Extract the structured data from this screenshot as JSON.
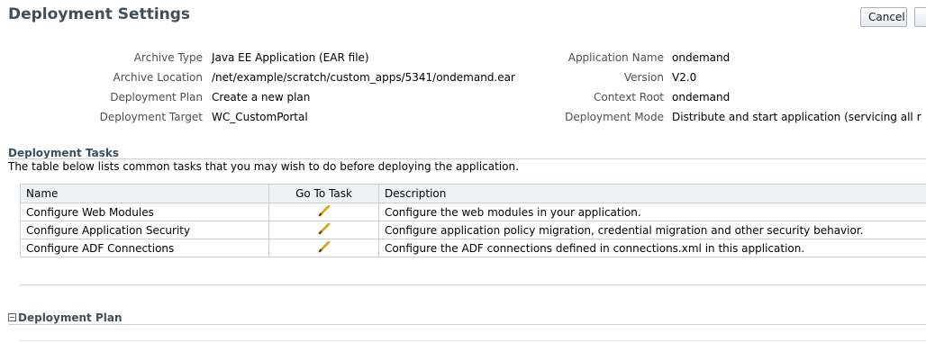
{
  "header": {
    "title": "Deployment Settings",
    "cancel_label": "Cancel"
  },
  "properties": {
    "left": [
      {
        "label": "Archive Type",
        "value": "Java EE Application (EAR file)"
      },
      {
        "label": "Archive Location",
        "value": "/net/example/scratch/custom_apps/5341/ondemand.ear"
      },
      {
        "label": "Deployment Plan",
        "value": "Create a new plan"
      },
      {
        "label": "Deployment Target",
        "value": "WC_CustomPortal"
      }
    ],
    "right": [
      {
        "label": "Application Name",
        "value": "ondemand"
      },
      {
        "label": "Version",
        "value": "V2.0"
      },
      {
        "label": "Context Root",
        "value": "ondemand"
      },
      {
        "label": "Deployment Mode",
        "value": "Distribute and start application (servicing all r"
      }
    ]
  },
  "tasks": {
    "title": "Deployment Tasks",
    "description": "The table below lists common tasks that you may wish to do before deploying the application.",
    "columns": [
      "Name",
      "Go To Task",
      "Description"
    ],
    "rows": [
      {
        "name": "Configure Web Modules",
        "description": "Configure the web modules in your application."
      },
      {
        "name": "Configure Application Security",
        "description": "Configure application policy migration, credential migration and other security behavior."
      },
      {
        "name": "Configure ADF Connections",
        "description": "Configure the ADF connections defined in connections.xml in this application."
      }
    ]
  },
  "plan": {
    "title": "Deployment Plan"
  },
  "colors": {
    "accent": "#3d4f5c",
    "pencil": "#e39b16",
    "border": "#c9d1d8"
  },
  "icons": {
    "edit": "pencil-icon",
    "collapse": "collapse-toggle-icon"
  }
}
